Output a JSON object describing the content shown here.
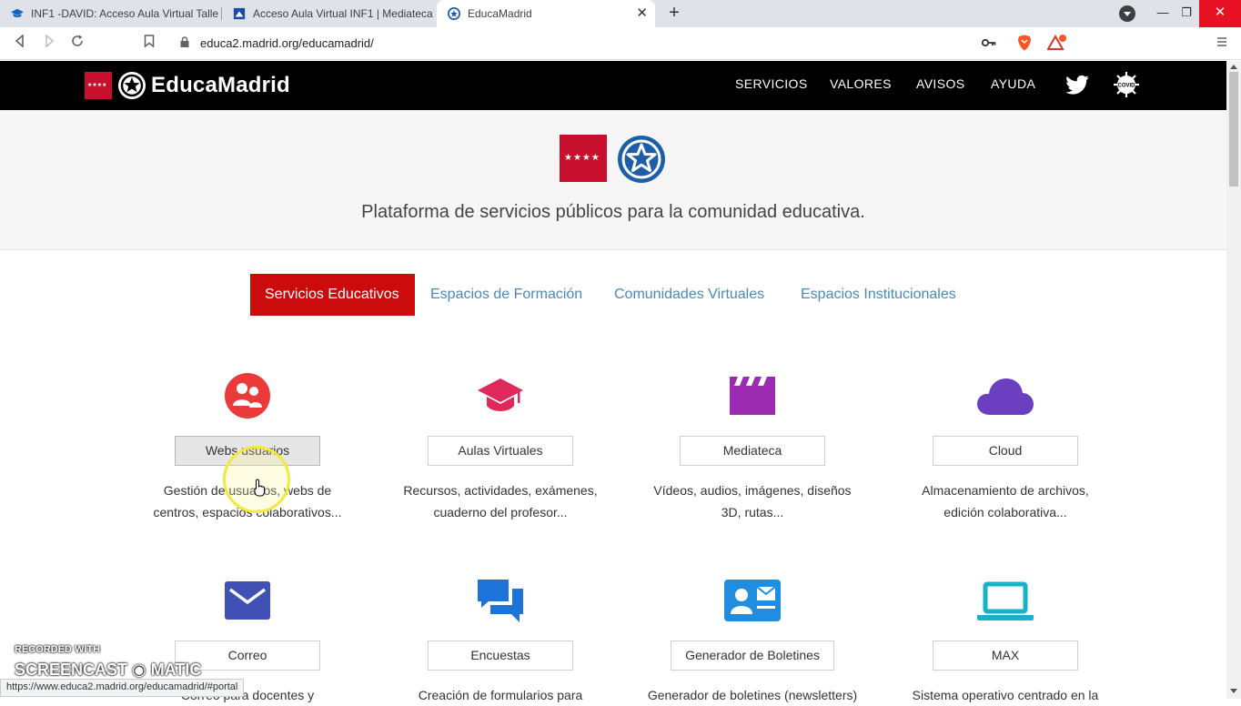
{
  "browser": {
    "tabs": [
      {
        "title": "INF1 -DAVID: Acceso Aula Virtual Talle"
      },
      {
        "title": "Acceso Aula Virtual INF1 | Mediateca"
      },
      {
        "title": "EducaMadrid"
      }
    ],
    "address": "educa2.madrid.org/educamadrid/",
    "status_url": "https://www.educa2.madrid.org/educamadrid/#portal",
    "close_glyph": "✕",
    "newtab_glyph": "+"
  },
  "header": {
    "brand": "EducaMadrid",
    "flag_stars": "★★★★",
    "nav": [
      "SERVICIOS",
      "VALORES",
      "AVISOS",
      "AYUDA"
    ],
    "covid_label": "COVID"
  },
  "hero": {
    "flag_stars": "★★★★",
    "subtitle": "Plataforma de servicios públicos para la comunidad educativa."
  },
  "tabs": [
    "Servicios Educativos",
    "Espacios de Formación",
    "Comunidades Virtuales",
    "Espacios Institucionales"
  ],
  "services": [
    {
      "label": "Webs usuarios",
      "desc1": "Gestión de usuarios, webs de",
      "desc2": "centros, espacios colaborativos...",
      "icon": "users-icon",
      "color": "#ea3a3a"
    },
    {
      "label": "Aulas Virtuales",
      "desc1": "Recursos, actividades, exámenes,",
      "desc2": "cuaderno del profesor...",
      "icon": "graduation-cap-icon",
      "color": "#e0285a"
    },
    {
      "label": "Mediateca",
      "desc1": "Vídeos, audios, imágenes, diseños",
      "desc2": "3D, rutas...",
      "icon": "clapperboard-icon",
      "color": "#9b2bb0"
    },
    {
      "label": "Cloud",
      "desc1": "Almacenamiento de archivos,",
      "desc2": "edición colaborativa...",
      "icon": "cloud-icon",
      "color": "#6b3fc0"
    },
    {
      "label": "Correo",
      "desc1": "Correo para docentes y",
      "desc2": "",
      "icon": "envelope-icon",
      "color": "#3f51b5"
    },
    {
      "label": "Encuestas",
      "desc1": "Creación de formularios para",
      "desc2": "",
      "icon": "chat-bubbles-icon",
      "color": "#1e73d8"
    },
    {
      "label": "Generador de Boletines",
      "desc1": "Generador de boletines (newsletters)",
      "desc2": "",
      "icon": "contact-card-icon",
      "color": "#1f8ee0"
    },
    {
      "label": "MAX",
      "desc1": "Sistema operativo centrado en la",
      "desc2": "",
      "icon": "laptop-icon",
      "color": "#16b3c8"
    }
  ],
  "watermark": {
    "line1": "RECORDED WITH",
    "line2": "SCREENCAST ◉ MATIC"
  }
}
